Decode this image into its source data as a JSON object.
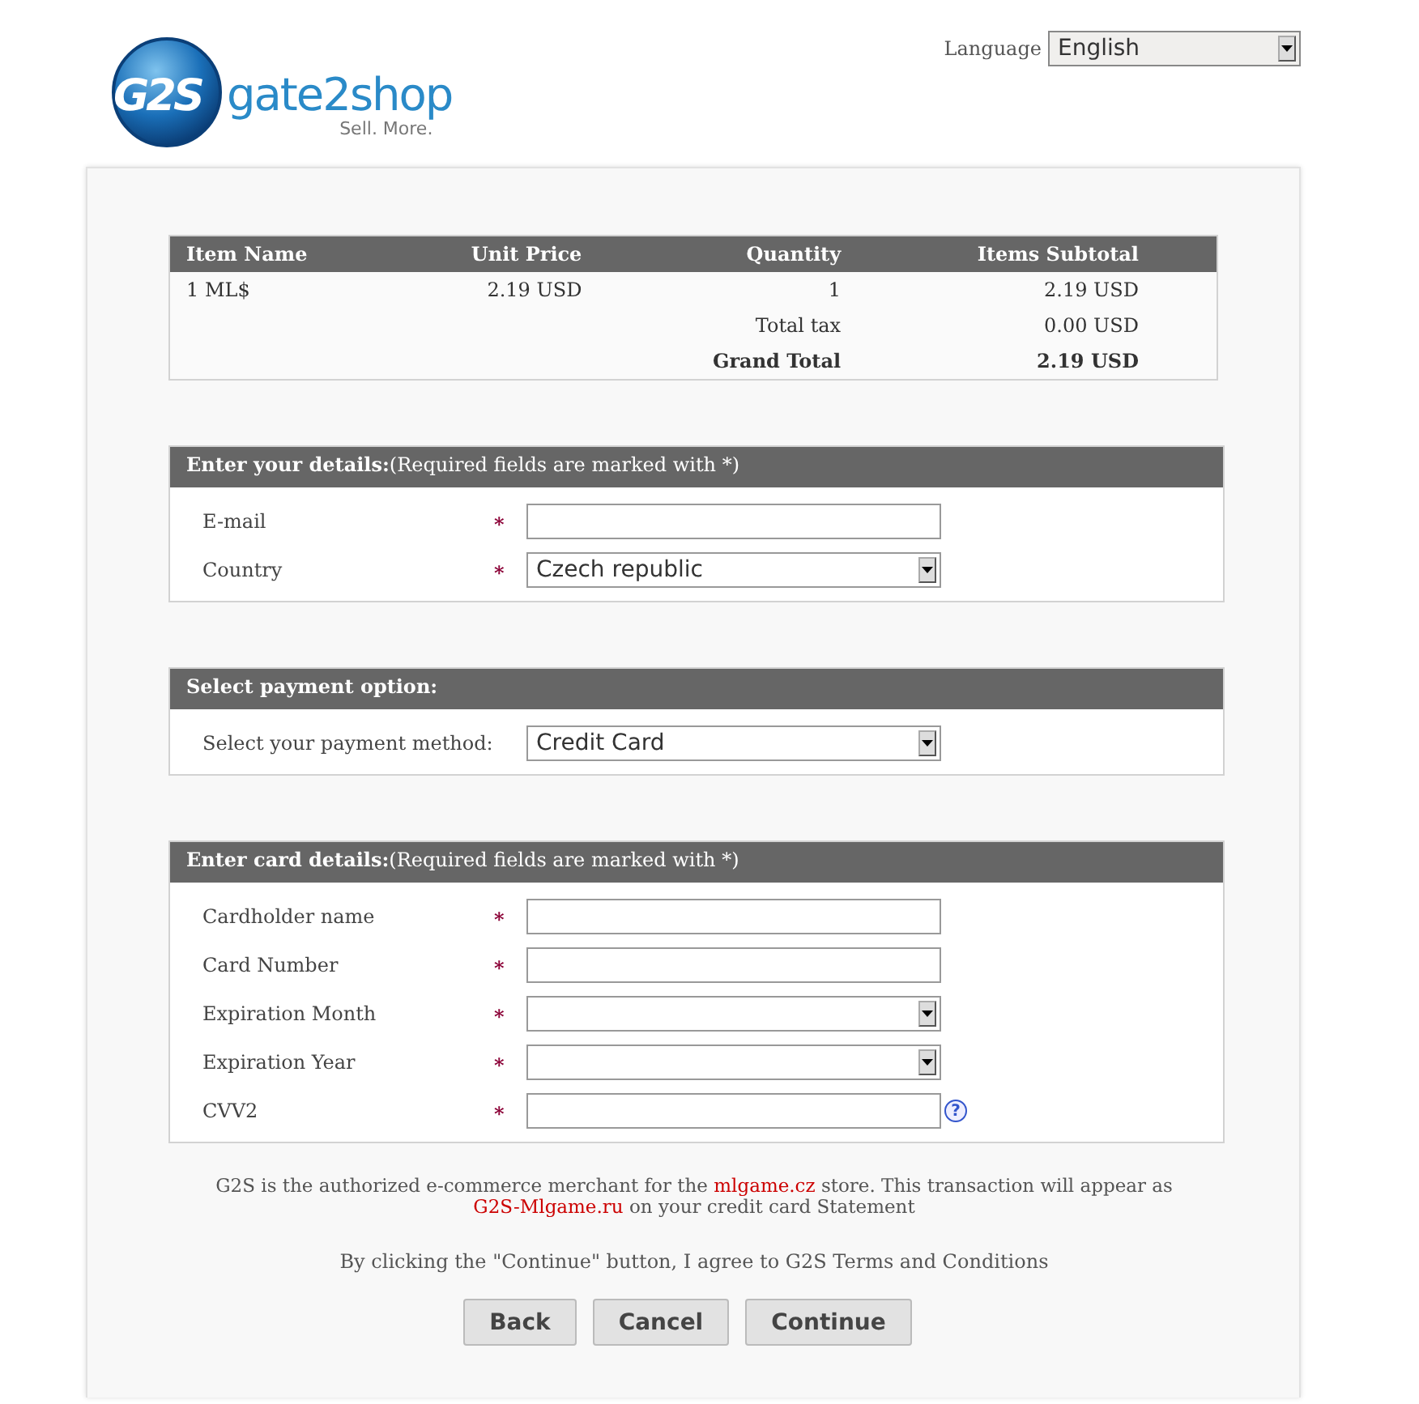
{
  "logo": {
    "badge": "G2S",
    "name": "gate2shop",
    "tagline": "Sell. More."
  },
  "language": {
    "label": "Language",
    "value": "English"
  },
  "order": {
    "columns": [
      "Item Name",
      "Unit Price",
      "Quantity",
      "Items Subtotal"
    ],
    "rows": [
      {
        "cells": [
          "1 ML$",
          "2.19 USD",
          "1",
          "2.19 USD"
        ],
        "bold": false
      },
      {
        "cells": [
          "",
          "",
          "Total tax",
          "0.00 USD"
        ],
        "bold": false
      },
      {
        "cells": [
          "",
          "",
          "Grand Total",
          "2.19 USD"
        ],
        "bold": true
      }
    ]
  },
  "sections": [
    {
      "title": "Enter your details:",
      "note": "(Required fields are marked with *)",
      "fields": [
        {
          "label": "E-mail",
          "required_mark": "*",
          "kind": "text"
        },
        {
          "label": "Country",
          "required_mark": "*",
          "kind": "select",
          "value": "Czech republic"
        }
      ]
    },
    {
      "title": "Select payment option:",
      "fields": [
        {
          "label": "Select your payment method:",
          "kind": "select",
          "value": "Credit Card"
        }
      ]
    },
    {
      "title": "Enter card details:",
      "note": "(Required fields are marked with *)",
      "fields": [
        {
          "label": "Cardholder name",
          "required_mark": "*",
          "kind": "text"
        },
        {
          "label": "Card Number",
          "required_mark": "*",
          "kind": "text"
        },
        {
          "label": "Expiration Month",
          "required_mark": "*",
          "kind": "select"
        },
        {
          "label": "Expiration Year",
          "required_mark": "*",
          "kind": "select"
        },
        {
          "label": "CVV2",
          "required_mark": "*",
          "kind": "text",
          "help_symbol": "?"
        }
      ]
    }
  ],
  "notice": [
    {
      "text": "G2S is the authorized e-commerce merchant for the ",
      "highlight": false
    },
    {
      "text": "mlgame.cz",
      "highlight": true
    },
    {
      "text": " store. This transaction will appear as ",
      "highlight": false
    },
    {
      "text": "G2S-Mlgame.ru",
      "highlight": true
    },
    {
      "text": " on your credit card Statement",
      "highlight": false
    }
  ],
  "agreement": "By clicking the \"Continue\" button, I agree to G2S Terms and Conditions",
  "buttons": [
    "Back",
    "Cancel",
    "Continue"
  ]
}
